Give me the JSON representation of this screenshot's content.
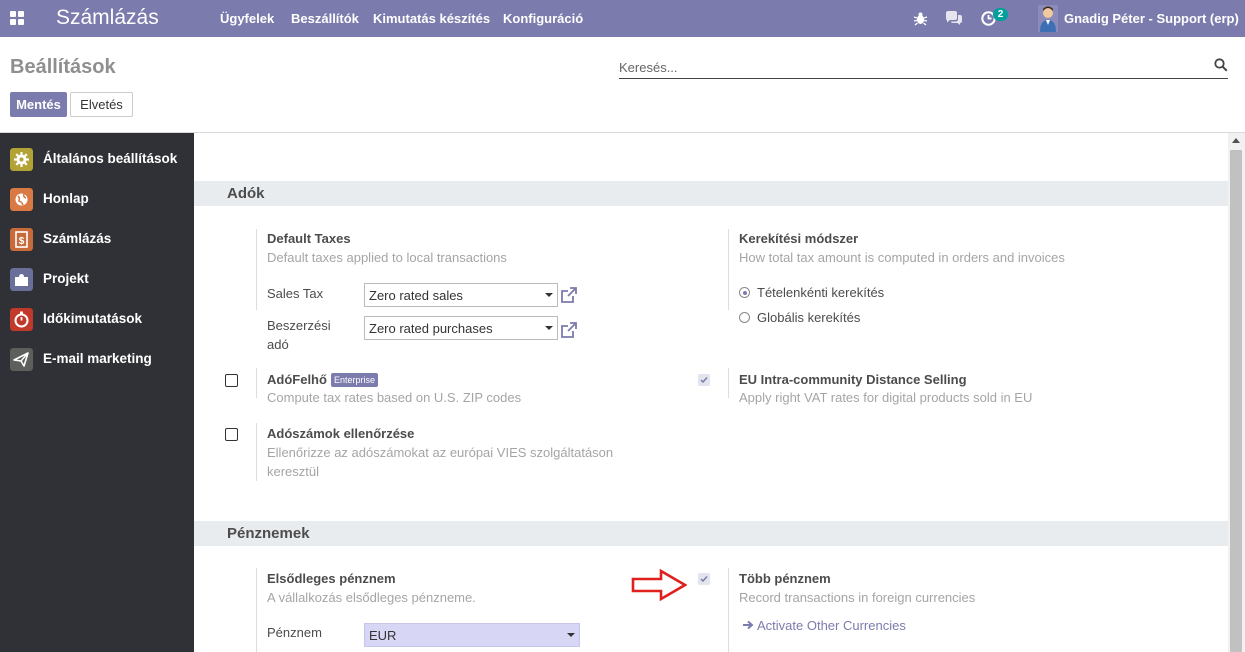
{
  "navbar": {
    "brand": "Számlázás",
    "menu": [
      "Ügyfelek",
      "Beszállítók",
      "Kimutatás készítés",
      "Konfiguráció"
    ],
    "activity_badge": "2",
    "user_name": "Gnadig Péter - Support (erp)"
  },
  "control_panel": {
    "title": "Beállítások",
    "search_placeholder": "Keresés...",
    "save_label": "Mentés",
    "discard_label": "Elvetés"
  },
  "sidebar": {
    "items": [
      {
        "label": "Általános beállítások",
        "color": "#b3a235"
      },
      {
        "label": "Honlap",
        "color": "#d97a45"
      },
      {
        "label": "Számlázás",
        "color": "#c86b3a"
      },
      {
        "label": "Projekt",
        "color": "#6a6f9a"
      },
      {
        "label": "Időkimutatások",
        "color": "#c0392b"
      },
      {
        "label": "E-mail marketing",
        "color": "#5c5f5c"
      }
    ]
  },
  "taxes": {
    "section_title": "Adók",
    "default_taxes": {
      "title": "Default Taxes",
      "desc": "Default taxes applied to local transactions",
      "sales_tax_label": "Sales Tax",
      "sales_tax_value": "Zero rated sales",
      "purchase_tax_label_1": "Beszerzési",
      "purchase_tax_label_2": "adó",
      "purchase_tax_value": "Zero rated purchases"
    },
    "rounding": {
      "title": "Kerekítési módszer",
      "desc": "How total tax amount is computed in orders and invoices",
      "option_1": "Tételenkénti kerekítés",
      "option_2": "Globális kerekítés",
      "selected": 1
    },
    "taxcloud": {
      "title": "AdóFelhő",
      "badge": "Enterprise",
      "desc": "Compute tax rates based on U.S. ZIP codes",
      "checked": false
    },
    "eu_distance": {
      "title": "EU Intra-community Distance Selling",
      "desc": "Apply right VAT rates for digital products sold in EU",
      "checked": true
    },
    "vies": {
      "title": "Adószámok ellenőrzése",
      "desc_1": "Ellenőrizze az adószámokat az európai VIES szolgáltatáson",
      "desc_2": "keresztül",
      "checked": false
    }
  },
  "currencies": {
    "section_title": "Pénznemek",
    "main_currency": {
      "title": "Elsődleges pénznem",
      "desc": "A vállalkozás elsődleges pénzneme.",
      "field_label": "Pénznem",
      "value": "EUR"
    },
    "multi_currency": {
      "title": "Több pénznem",
      "desc": "Record transactions in foreign currencies",
      "link": "Activate Other Currencies",
      "checked": true
    }
  },
  "colors": {
    "brand": "#7c7bad",
    "sidebar_bg": "#2f3136",
    "annotation_arrow": "#e0201c"
  }
}
